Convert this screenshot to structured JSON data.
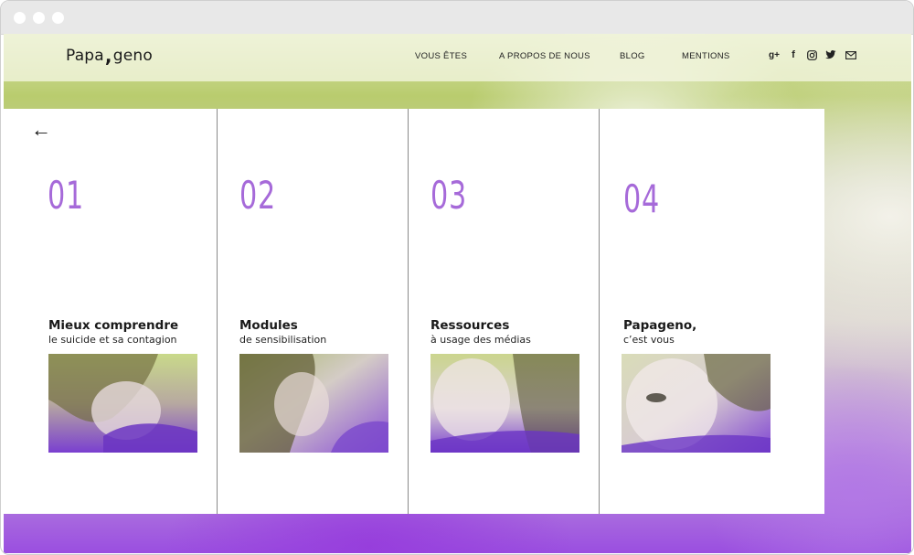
{
  "brand": {
    "logo_left": "Papa",
    "logo_comma": ",",
    "logo_right": "geno"
  },
  "nav": {
    "items": [
      "VOUS ÊTES",
      "A PROPOS DE NOUS",
      "BLOG",
      "MENTIONS"
    ]
  },
  "social": {
    "icons": [
      "google-plus-icon",
      "facebook-icon",
      "instagram-icon",
      "twitter-icon",
      "mail-icon"
    ],
    "gplus_text": "g+",
    "facebook_text": "f"
  },
  "back": {
    "icon": "←"
  },
  "cards": [
    {
      "number": "01",
      "title": "Mieux comprendre",
      "subtitle": "le suicide et sa contagion"
    },
    {
      "number": "02",
      "title": "Modules",
      "subtitle": "de sensibilisation"
    },
    {
      "number": "03",
      "title": "Ressources",
      "subtitle": "à usage des médias"
    },
    {
      "number": "04",
      "title": "Papageno,",
      "subtitle": "c’est vous"
    }
  ],
  "colors": {
    "accent": "#a66ad9",
    "green_tint": "#b9cc6e",
    "purple_tint": "#7a3fd0"
  }
}
